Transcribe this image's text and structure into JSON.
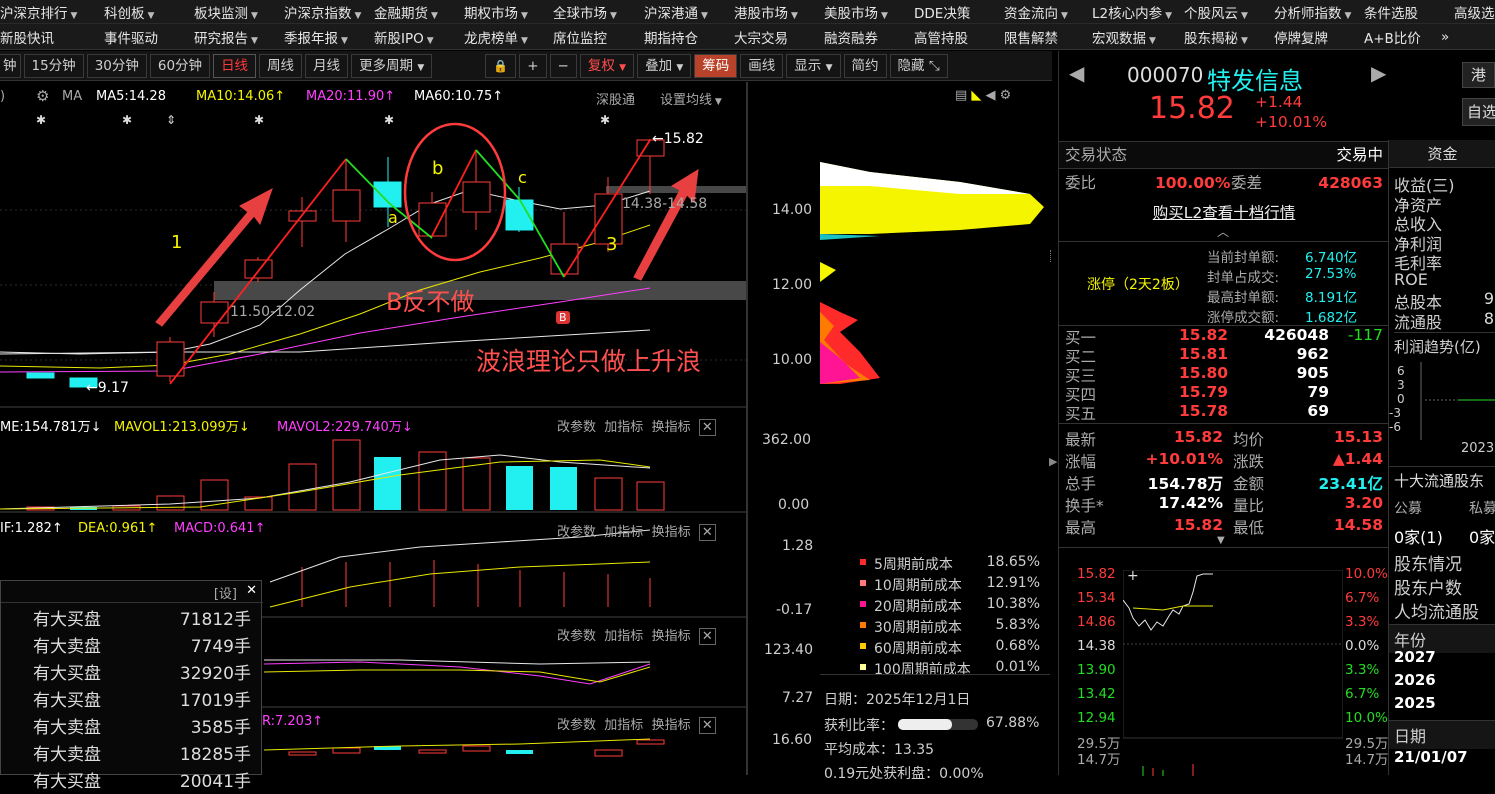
{
  "nav1": [
    "沪深京排行",
    "科创板",
    "板块监测",
    "沪深京指数",
    "金融期货",
    "期权市场",
    "全球市场",
    "沪深港通",
    "港股市场",
    "美股市场",
    "DDE决策",
    "资金流向",
    "L2核心内参",
    "个股风云",
    "分析师指数",
    "条件选股",
    "高级选"
  ],
  "nav1_dd": [
    true,
    true,
    true,
    true,
    true,
    true,
    true,
    true,
    true,
    true,
    false,
    true,
    true,
    true,
    true,
    false,
    false
  ],
  "nav2": [
    "新股快讯",
    "事件驱动",
    "研究报告",
    "季报年报",
    "新股IPO",
    "龙虎榜单",
    "席位监控",
    "期指持仓",
    "大宗交易",
    "融资融券",
    "高管持股",
    "限售解禁",
    "宏观数据",
    "股东揭秘",
    "停牌复牌",
    "A+B比价"
  ],
  "nav2_dd": [
    false,
    false,
    true,
    true,
    true,
    true,
    false,
    false,
    false,
    false,
    false,
    false,
    true,
    true,
    false,
    false
  ],
  "more_glyph": "»",
  "toolbar": {
    "p0": "钟",
    "p1": "15分钟",
    "p2": "30分钟",
    "p3": "60分钟",
    "p4": "日线",
    "p5": "周线",
    "p6": "月线",
    "p7": "更多周期",
    "lock": "🔒",
    "plus": "+",
    "minus": "−",
    "fq": "复权",
    "overlay": "叠加",
    "chip": "筹码",
    "draw": "画线",
    "show": "显示",
    "simple": "简约",
    "hide": "隐藏",
    "expand": "⤡"
  },
  "ma": {
    "paren": ")",
    "ma": "MA",
    "ma5": "MA5:14.28",
    "ma10": "MA10:14.06",
    "ma20": "MA20:11.90",
    "ma60": "MA60:10.75",
    "arrow": "↑",
    "deep": "深股通",
    "setma": "设置均线"
  },
  "price_axis": [
    "14.00",
    "12.00",
    "10.00"
  ],
  "annot": {
    "n1": "1",
    "a": "a",
    "b": "b",
    "c": "c",
    "n3": "3",
    "hi": "←15.82",
    "lo": "←9.17",
    "range1": "14.38-14.58",
    "range2": "11.50-12.02",
    "bfan": "B反不做",
    "wave": "波浪理论只做上升浪",
    "bicon": "B"
  },
  "vol": {
    "title": "ME:154.781万",
    "mavol1": "MAVOL1:213.099万",
    "mavol2": "MAVOL2:229.740万",
    "down": "↓",
    "ax1": "362.00",
    "ax2": "0.00"
  },
  "macd": {
    "dif": "IF:1.282",
    "dea": "DEA:0.961",
    "macd": "MACD:0.641",
    "up": "↑",
    "ax1": "1.28",
    "ax2": "-0.17"
  },
  "p4": {
    "ax1": "123.40",
    "ax2": "7.27"
  },
  "p5": {
    "title": "R:7.203",
    "up": "↑",
    "ax1": "16.60"
  },
  "ind_btns": {
    "gcs": "改参数",
    "jzb": "加指标",
    "hzb": "换指标",
    "close": "✕"
  },
  "chip_legend": [
    {
      "label": "5周期前成本",
      "value": "18.65%",
      "color": "#ff2a2a"
    },
    {
      "label": "10周期前成本",
      "value": "12.91%",
      "color": "#ff7a7a"
    },
    {
      "label": "20周期前成本",
      "value": "10.38%",
      "color": "#ff1493"
    },
    {
      "label": "30周期前成本",
      "value": "5.83%",
      "color": "#ff7a00"
    },
    {
      "label": "60周期前成本",
      "value": "0.68%",
      "color": "#ffcc00"
    },
    {
      "label": "100周期前成本",
      "value": "0.01%",
      "color": "#ffff99"
    }
  ],
  "chip_info": {
    "date": "日期：2025年12月1日",
    "profit_label": "获利比率：",
    "profit": "67.88%",
    "avg": "平均成本：13.35",
    "tail": "0.19元处获利盘：0.00%"
  },
  "ctable": {
    "header": "[设]",
    "close": "✕",
    "rows": [
      {
        "a": "有大买盘",
        "b": "71812手"
      },
      {
        "a": "有大卖盘",
        "b": "7749手"
      },
      {
        "a": "有大买盘",
        "b": "32920手"
      },
      {
        "a": "有大买盘",
        "b": "17019手"
      },
      {
        "a": "有大卖盘",
        "b": "3585手"
      },
      {
        "a": "有大卖盘",
        "b": "18285手"
      },
      {
        "a": "有大买盘",
        "b": "20041手"
      }
    ]
  },
  "stock": {
    "code": "000070",
    "name": "特发信息",
    "price": "15.82",
    "chg": "+1.44",
    "pct": "+10.01%",
    "status_l": "交易状态",
    "status_r": "交易中",
    "weibi_l": "委比",
    "weibi": "100.00%",
    "weicha_l": "委差",
    "weicha": "428063",
    "l2": "购买L2查看十档行情",
    "zt": "涨停（2天2板）",
    "cur_l": "当前封单额:",
    "cur": "6.740亿",
    "zb_l": "封单占成交:",
    "zb": "27.53%",
    "max_l": "最高封单额:",
    "max": "8.191亿",
    "zt_l": "涨停成交额:",
    "ztv": "1.682亿"
  },
  "book": [
    {
      "l": "买一",
      "p": "15.82",
      "v": "426048",
      "d": "-117"
    },
    {
      "l": "买二",
      "p": "15.81",
      "v": "962",
      "d": ""
    },
    {
      "l": "买三",
      "p": "15.80",
      "v": "905",
      "d": ""
    },
    {
      "l": "买四",
      "p": "15.79",
      "v": "79",
      "d": ""
    },
    {
      "l": "买五",
      "p": "15.78",
      "v": "69",
      "d": ""
    }
  ],
  "stats": [
    {
      "l1": "最新",
      "v1": "15.82",
      "l2": "均价",
      "v2": "15.13"
    },
    {
      "l1": "涨幅",
      "v1": "+10.01%",
      "l2": "涨跌",
      "v2": "▲1.44"
    },
    {
      "l1": "总手",
      "v1": "154.78万",
      "l2": "金额",
      "v2": "23.41亿"
    },
    {
      "l1": "换手*",
      "v1": "17.42%",
      "l2": "量比",
      "v2": "3.20"
    },
    {
      "l1": "最高",
      "v1": "15.82",
      "l2": "最低",
      "v2": "14.58"
    }
  ],
  "mini": {
    "left": [
      "15.82",
      "15.34",
      "14.86",
      "14.38",
      "13.90",
      "13.42",
      "12.94",
      "29.5万",
      "14.7万"
    ],
    "right": [
      "10.0%",
      "6.7%",
      "3.3%",
      "0.0%",
      "3.3%",
      "6.7%",
      "10.0%",
      "29.5万",
      "14.7万"
    ]
  },
  "far": {
    "btn1": "港",
    "btn2": "自选",
    "tab": "资金",
    "items": [
      "收益(三)",
      "净资产",
      "总收入",
      "净利润",
      "毛利率",
      "ROE",
      "总股本",
      "流通股"
    ],
    "vals": [
      "",
      "",
      "",
      "",
      "",
      "",
      "9",
      "8"
    ],
    "trend": "利润趋势(亿)",
    "ticks": [
      "6",
      "3",
      "0",
      "-3",
      "-6"
    ],
    "year": "2023",
    "holders": "十大流通股东",
    "pub": "公募",
    "pri": "私募",
    "home": "0家(1)",
    "home2": "0家",
    "s1": "股东情况",
    "s2": "股东户数",
    "s3": "人均流通股",
    "ylab": "年份",
    "years": [
      "2027",
      "2026",
      "2025"
    ],
    "dlab": "日期",
    "date": "21/01/07"
  }
}
